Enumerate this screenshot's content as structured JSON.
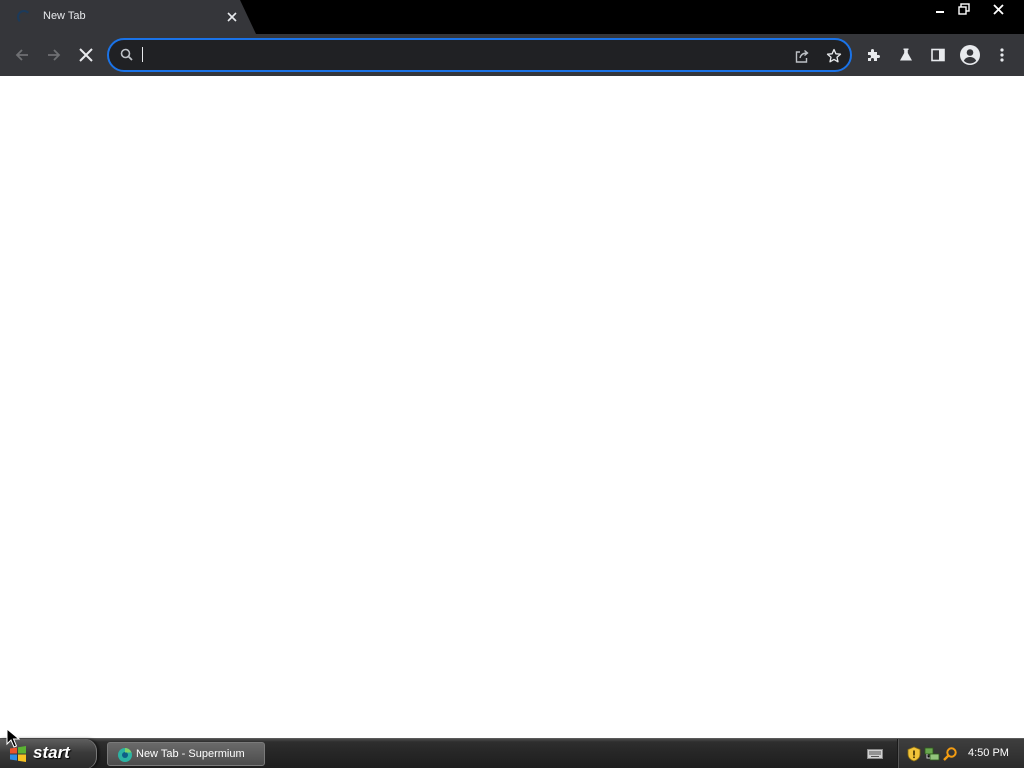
{
  "browser": {
    "tab": {
      "title": "New Tab",
      "favicon": "loading-spinner-icon",
      "close_icon": "close-icon"
    },
    "window_controls": {
      "minimize": "minimize-icon",
      "restore": "restore-icon",
      "close": "close-icon"
    },
    "toolbar": {
      "back": "arrow-left-icon",
      "forward": "arrow-right-icon",
      "stop": "close-icon",
      "omnibox": {
        "value": "",
        "placeholder": "",
        "search_icon": "search-icon",
        "share_icon": "share-icon",
        "bookmark_icon": "star-icon"
      },
      "extensions": "puzzle-icon",
      "labs": "flask-icon",
      "side_panel": "side-panel-icon",
      "profile": "person-circle-icon",
      "menu": "kebab-menu-icon"
    },
    "colors": {
      "frame": "#000000",
      "toolbar": "#35363a",
      "omnibox_bg": "#202124",
      "focus_ring": "#1a73e8",
      "content_bg": "#ffffff"
    }
  },
  "taskbar": {
    "start_label": "start",
    "items": [
      {
        "label": "New Tab - Supermium",
        "icon": "supermium-icon"
      }
    ],
    "tray": {
      "icons": [
        "keyboard-icon",
        "shield-icon",
        "network-icon",
        "search-icon"
      ],
      "clock": "4:50 PM"
    }
  }
}
